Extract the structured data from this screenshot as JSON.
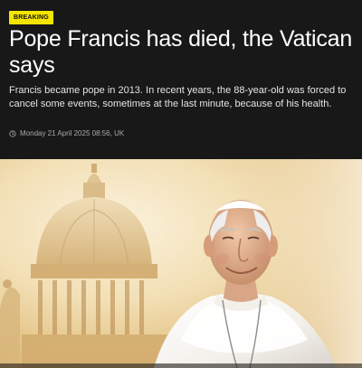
{
  "article": {
    "badge": "BREAKING",
    "headline": "Pope Francis has died, the Vatican says",
    "standfirst": "Francis became pope in 2013. In recent years, the 88-year-old was forced to cancel some events, sometimes at the last minute, because of his health.",
    "timestamp": "Monday 21 April 2025 08:56, UK"
  },
  "icons": {
    "timestamp_icon": "clock-icon"
  },
  "colors": {
    "badge_background": "#f5e500",
    "header_background": "#181818"
  }
}
